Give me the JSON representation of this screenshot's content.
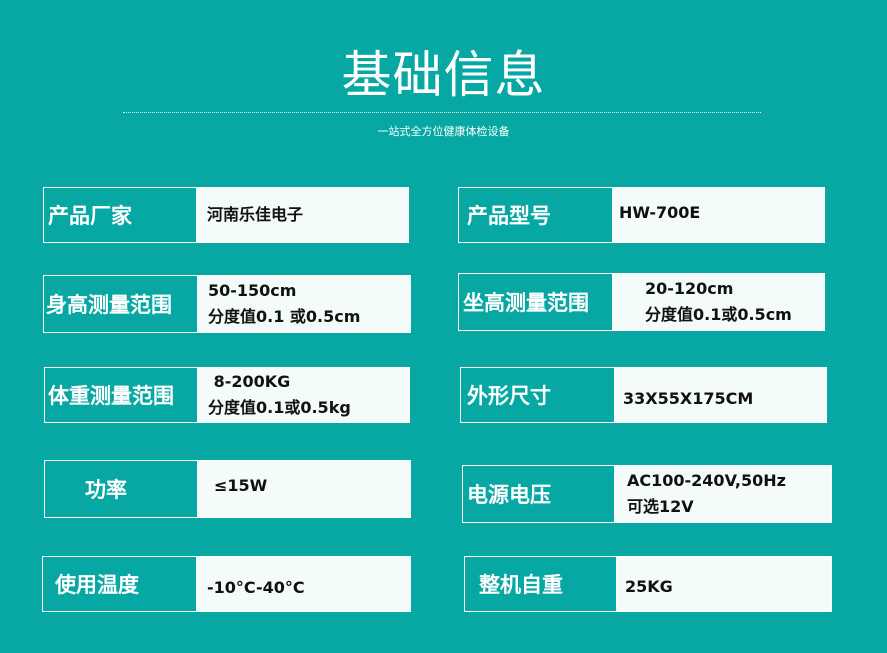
{
  "header": {
    "title": "基础信息",
    "subtitle": "一站式全方位健康体检设备"
  },
  "specs": {
    "manufacturer": {
      "label": "产品厂家",
      "lines": [
        "河南乐佳电子"
      ]
    },
    "model": {
      "label": "产品型号",
      "lines": [
        "HW-700E"
      ]
    },
    "height_range": {
      "label": "身高测量范围",
      "lines": [
        "50-150cm",
        "分度值0.1 或0.5cm"
      ]
    },
    "sitting_height_range": {
      "label": "坐高测量范围",
      "lines": [
        "20-120cm",
        "分度值0.1或0.5cm"
      ]
    },
    "weight_range": {
      "label": "体重测量范围",
      "lines": [
        " 8-200KG",
        "分度值0.1或0.5kg"
      ]
    },
    "dimensions": {
      "label": "外形尺寸",
      "lines": [
        "33X55X175CM"
      ]
    },
    "power": {
      "label": "功率",
      "lines": [
        "≤15W"
      ]
    },
    "voltage": {
      "label": "电源电压",
      "lines": [
        "AC100-240V,50Hz",
        "可选12V"
      ]
    },
    "temperature": {
      "label": "使用温度",
      "lines": [
        "-10°C-40°C"
      ]
    },
    "net_weight": {
      "label": "整机自重",
      "lines": [
        "25KG"
      ]
    }
  }
}
